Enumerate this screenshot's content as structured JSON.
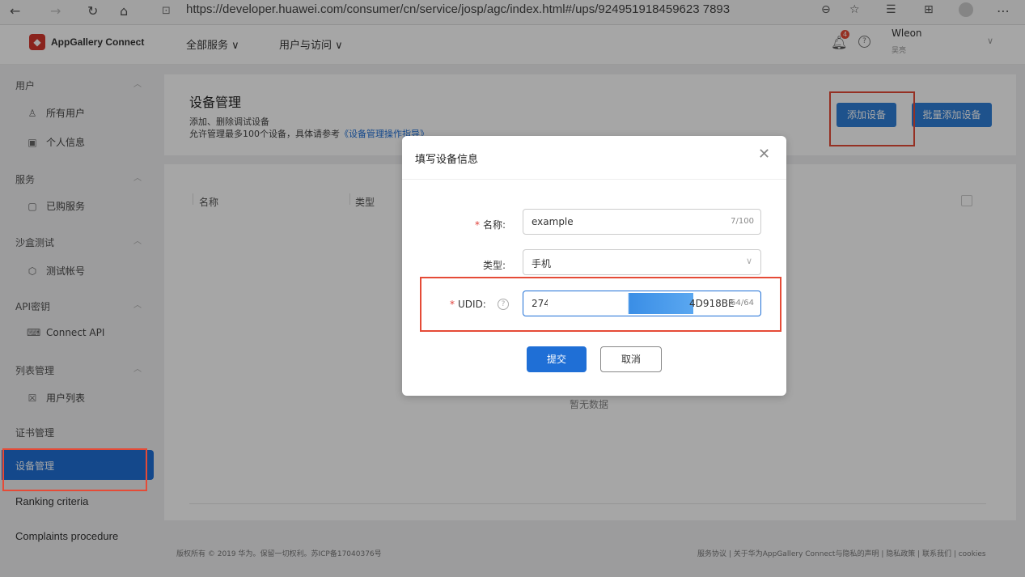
{
  "browser": {
    "url": "https://developer.huawei.com/consumer/cn/service/josp/agc/index.html#/ups/924951918459623 7893"
  },
  "header": {
    "brand": "AppGallery Connect",
    "menus": [
      "全部服务 ∨",
      "用户与访问 ∨"
    ],
    "notif_count": "4",
    "user_name": "Wleon",
    "user_sub": "吴亮"
  },
  "sidebar": {
    "sections": [
      {
        "title": "用户",
        "items": [
          "所有用户",
          "个人信息"
        ]
      },
      {
        "title": "服务",
        "items": [
          "已购服务"
        ]
      },
      {
        "title": "沙盒测试",
        "items": [
          "测试帐号"
        ]
      },
      {
        "title": "API密钥",
        "items": [
          "Connect API"
        ]
      },
      {
        "title": "列表管理",
        "items": [
          "用户列表"
        ]
      }
    ],
    "cert": "证书管理",
    "active": "设备管理",
    "ranking": "Ranking criteria",
    "complaints": "Complaints procedure"
  },
  "page": {
    "title": "设备管理",
    "desc1": "添加、删除调试设备",
    "desc2_prefix": "允许管理最多100个设备，具体请参考",
    "desc2_link": "《设备管理操作指导》",
    "add_btn": "添加设备",
    "bulk_btn": "批量添加设备"
  },
  "table": {
    "headers": [
      "名称",
      "类型"
    ],
    "empty": "暂无数据"
  },
  "footer": {
    "left": "版权所有 © 2019 华为。保留一切权利。苏ICP备17040376号",
    "right": "服务协议 | 关于华为AppGallery Connect与隐私的声明 | 隐私政策 | 联系我们 | cookies"
  },
  "dialog": {
    "title": "填写设备信息",
    "name_label": "名称:",
    "name_value": "example",
    "name_count": "7/100",
    "type_label": "类型:",
    "type_value": "手机",
    "udid_label": "UDID:",
    "udid_prefix": "274",
    "udid_suffix": "4D918BE",
    "udid_count": "64/64",
    "submit": "提交",
    "cancel": "取消"
  },
  "colors": {
    "accent": "#1f6fd6",
    "annotation": "#e54b37"
  }
}
